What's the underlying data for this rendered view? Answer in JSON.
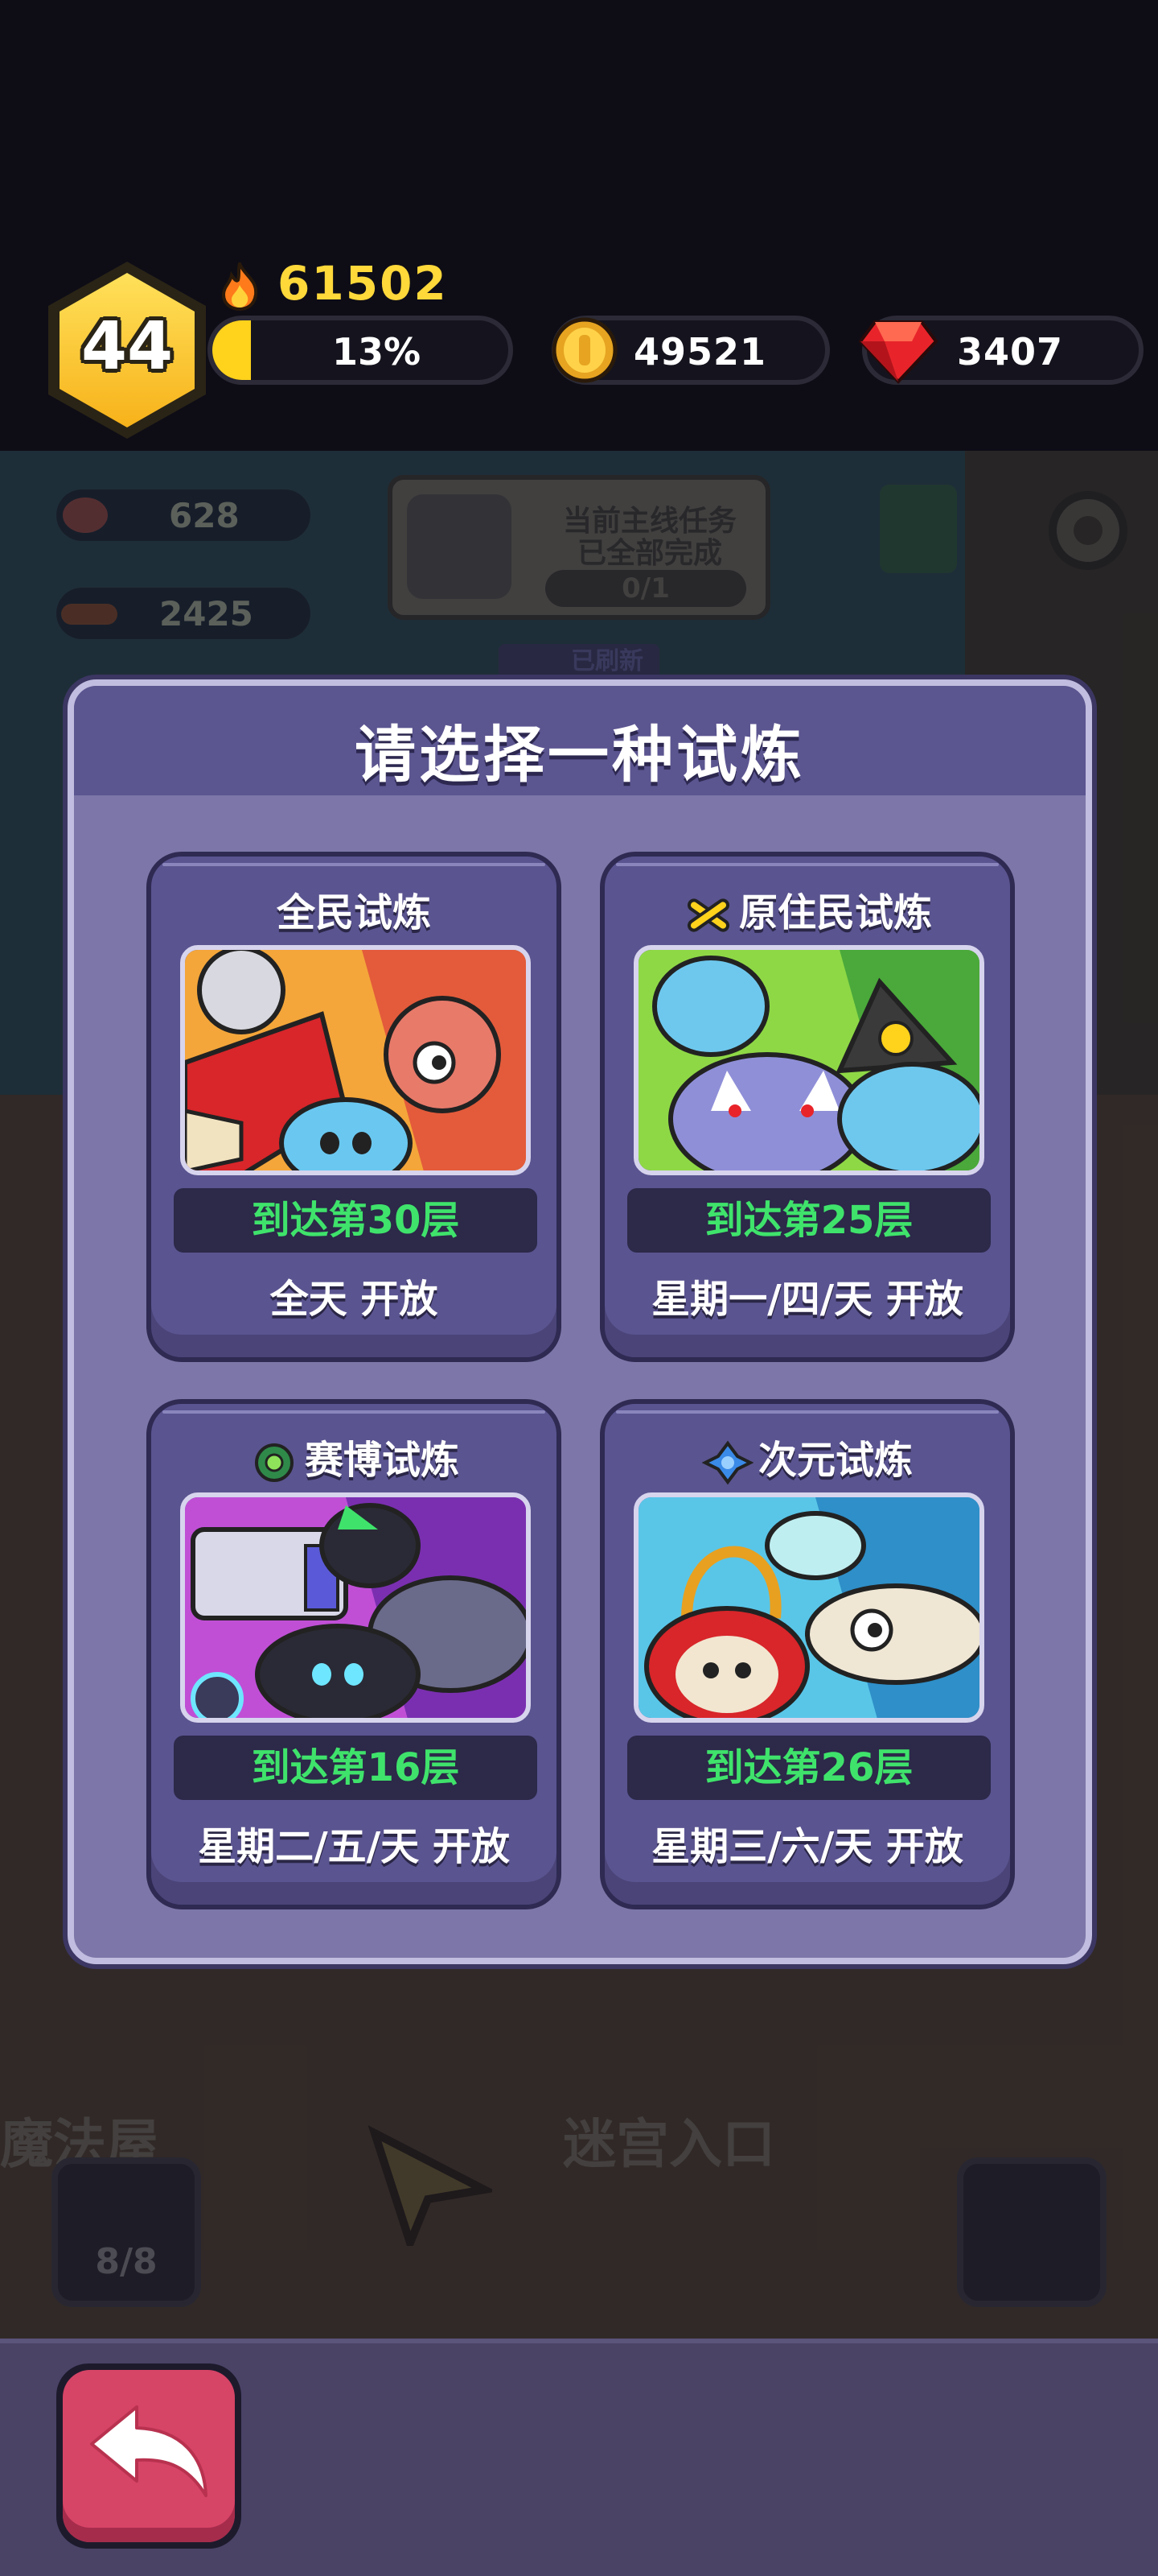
{
  "header": {
    "level": "44",
    "power": "61502",
    "xp_percent_label": "13%",
    "xp_fill_fraction": 0.13,
    "coins": "49521",
    "gems": "3407"
  },
  "scene": {
    "resource_meat": "628",
    "resource_wood": "2425",
    "quest_line1": "当前主线任务",
    "quest_line2": "已全部完成",
    "quest_progress": "0/1",
    "refresh_label": "已刷新",
    "magic_house_label": "魔法屋",
    "maze_entrance_label": "迷宫入口",
    "slot_counter": "8/8"
  },
  "modal": {
    "title": "请选择一种试炼",
    "cards": [
      {
        "title": "全民试炼",
        "requirement": "到达第30层",
        "schedule": "全天 开放",
        "icon": "none",
        "image_colors": [
          "#f4a63a",
          "#e35b3b"
        ]
      },
      {
        "title": "原住民试炼",
        "requirement": "到达第25层",
        "schedule": "星期一/四/天 开放",
        "icon": "crossed-bones-icon",
        "image_colors": [
          "#8ed846",
          "#4aa93a"
        ]
      },
      {
        "title": "赛博试炼",
        "requirement": "到达第16层",
        "schedule": "星期二/五/天 开放",
        "icon": "gear-cyber-icon",
        "image_colors": [
          "#c04fd6",
          "#7a2fb0"
        ]
      },
      {
        "title": "次元试炼",
        "requirement": "到达第26层",
        "schedule": "星期三/六/天 开放",
        "icon": "dimension-icon",
        "image_colors": [
          "#59c6e8",
          "#2f8fc8"
        ]
      }
    ]
  },
  "footer": {
    "back_icon": "back-arrow-icon"
  },
  "colors": {
    "requirement_green": "#3fe36b",
    "modal_bg": "#7c77a8",
    "card_bg": "#5a5490",
    "back_button": "#d64466",
    "gold": "#ffd21c"
  }
}
